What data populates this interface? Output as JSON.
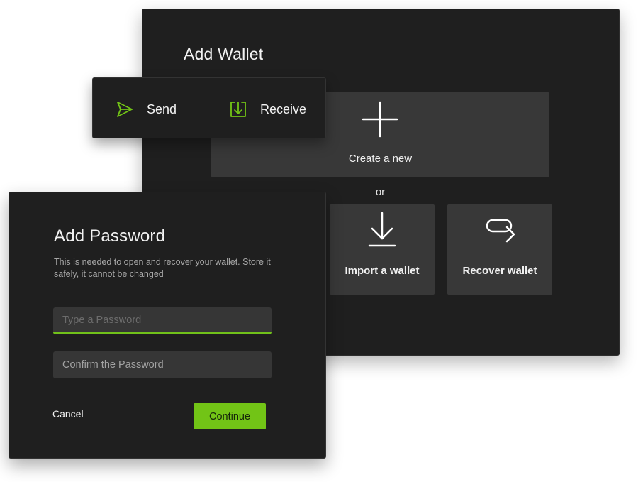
{
  "colors": {
    "panel_bg": "#1f1f1f",
    "card_bg": "#383838",
    "accent_green": "#72c416",
    "text_primary": "#f2f2f2",
    "text_muted": "#a8a8a8"
  },
  "wallet": {
    "title": "Add Wallet",
    "create": {
      "label": "Create a new",
      "icon": "plus-icon"
    },
    "or_text": "or",
    "import": {
      "label": "Import a wallet",
      "icon": "download-arrow-icon"
    },
    "recover": {
      "label": "Recover wallet",
      "icon": "return-arrow-icon"
    }
  },
  "actions": {
    "send": {
      "label": "Send",
      "icon": "send-icon"
    },
    "receive": {
      "label": "Receive",
      "icon": "receive-icon"
    }
  },
  "password_dialog": {
    "title": "Add Password",
    "description": "This is needed to open and recover your wallet. Store it safely, it cannot be changed",
    "password_field": {
      "value": "",
      "placeholder": "Type a Password"
    },
    "confirm_field": {
      "value": "",
      "placeholder": "Confirm the Password"
    },
    "cancel_label": "Cancel",
    "continue_label": "Continue"
  }
}
